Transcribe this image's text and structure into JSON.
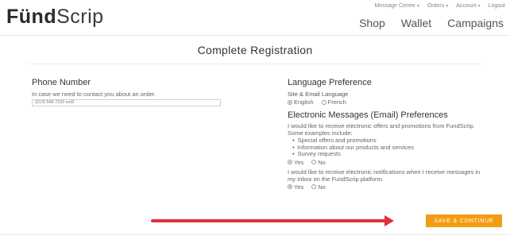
{
  "header": {
    "logo_prefix": "Fünd",
    "logo_suffix": "Scrip",
    "top_links": [
      "Message Centre",
      "Orders",
      "Account",
      "Logout"
    ],
    "main_links": [
      "Shop",
      "Wallet",
      "Campaigns"
    ]
  },
  "page": {
    "title": "Complete Registration"
  },
  "phone": {
    "heading": "Phone Number",
    "hint": "In case we need to contact you about an order.",
    "value": "(613) 549 7333 ext3"
  },
  "language": {
    "heading": "Language Preference",
    "sub": "Site & Email Language",
    "options": [
      "English",
      "French"
    ],
    "selected": "English"
  },
  "email_prefs": {
    "heading": "Electronic Messages (Email) Preferences",
    "offers_text": "I would like to receive electronic offers and promotions from FundScrip. Some examples include:",
    "examples": [
      "Special offers and promotions",
      "Information about our products and services",
      "Survey requests"
    ],
    "offers_options": [
      "Yes",
      "No"
    ],
    "offers_selected": "Yes",
    "notify_text": "I would like to receive electronic notifications when I receive messages in my Inbox on the FundScrip platform.",
    "notify_options": [
      "Yes",
      "No"
    ],
    "notify_selected": "Yes"
  },
  "actions": {
    "save_label": "SAVE & CONTINUE"
  },
  "colors": {
    "button_bg": "#f39c12",
    "arrow": "#e0303a"
  }
}
